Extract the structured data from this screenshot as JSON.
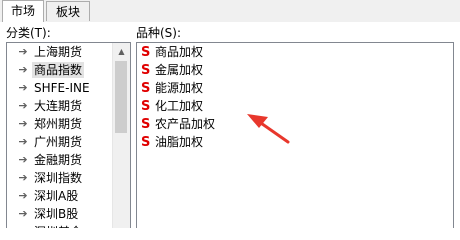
{
  "tabs": [
    {
      "label": "市场",
      "active": true
    },
    {
      "label": "板块",
      "active": false
    }
  ],
  "category_label": "分类(T):",
  "variety_label": "品种(S):",
  "categories": [
    {
      "label": "上海期货",
      "selected": false
    },
    {
      "label": "商品指数",
      "selected": true
    },
    {
      "label": "SHFE-INE",
      "selected": false
    },
    {
      "label": "大连期货",
      "selected": false
    },
    {
      "label": "郑州期货",
      "selected": false
    },
    {
      "label": "广州期货",
      "selected": false
    },
    {
      "label": "金融期货",
      "selected": false
    },
    {
      "label": "深圳指数",
      "selected": false
    },
    {
      "label": "深圳A股",
      "selected": false
    },
    {
      "label": "深圳B股",
      "selected": false
    },
    {
      "label": "深圳基金",
      "selected": false
    }
  ],
  "variety_marker": "S",
  "varieties": [
    {
      "label": "商品加权"
    },
    {
      "label": "金属加权"
    },
    {
      "label": "能源加权"
    },
    {
      "label": "化工加权"
    },
    {
      "label": "农产品加权"
    },
    {
      "label": "油脂加权"
    }
  ],
  "colors": {
    "marker": "#e00000",
    "arrow": "#e8372c",
    "selection": "#e2e2e2"
  },
  "icons": {
    "category_item": "arrow-right-icon",
    "scroll_up": "triangle-up-icon"
  }
}
